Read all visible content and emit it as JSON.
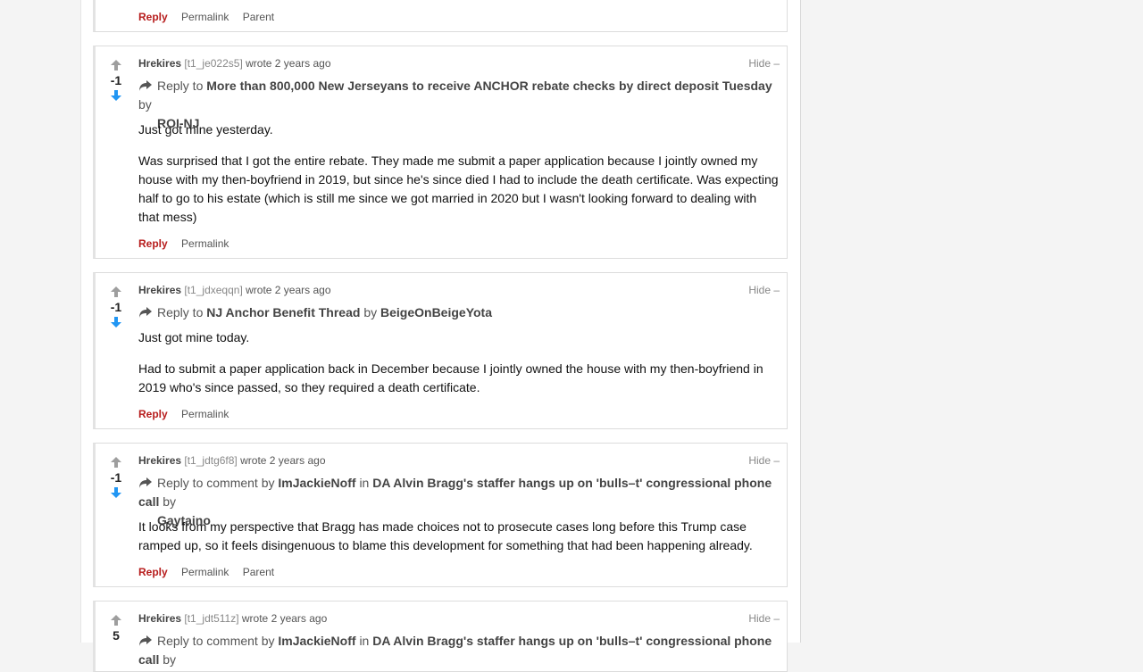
{
  "card0": {
    "actions": {
      "reply": "Reply",
      "permalink": "Permalink",
      "parent": "Parent"
    }
  },
  "card1": {
    "score": "-1",
    "author": "Hrekires",
    "comment_id": "[t1_je022s5]",
    "wrote": "wrote 2 years ago",
    "hide": "Hide –",
    "reply_prefix": "Reply to",
    "post_title": "More than 800,000 New Jerseyans to receive ANCHOR rebate checks by direct deposit Tuesday",
    "by_word": "by",
    "post_author": "ROI-NJ",
    "paragraphs": [
      "Just got mine yesterday.",
      "Was surprised that I got the entire rebate. They made me submit a paper application because I jointly owned my house with my then-boyfriend in 2019, but since he's since died I had to include the death certificate. Was expecting half to go to his estate (which is still me since we got married in 2020 but I wasn't looking forward to dealing with that mess)"
    ],
    "actions": {
      "reply": "Reply",
      "permalink": "Permalink"
    }
  },
  "card2": {
    "score": "-1",
    "author": "Hrekires",
    "comment_id": "[t1_jdxeqqn]",
    "wrote": "wrote 2 years ago",
    "hide": "Hide –",
    "reply_prefix": "Reply to",
    "post_title": "NJ Anchor Benefit Thread",
    "by_word": "by",
    "post_author": "BeigeOnBeigeYota",
    "paragraphs": [
      "Just got mine today.",
      "Had to submit a paper application back in December because I jointly owned the house with my then-boyfriend in 2019 who's since passed, so they required a death certificate."
    ],
    "actions": {
      "reply": "Reply",
      "permalink": "Permalink"
    }
  },
  "card3": {
    "score": "-1",
    "author": "Hrekires",
    "comment_id": "[t1_jdtg6f8]",
    "wrote": "wrote 2 years ago",
    "hide": "Hide –",
    "reply_prefix": "Reply to comment by",
    "comment_author": "ImJackieNoff",
    "in_word": "in",
    "post_title": "DA Alvin Bragg's staffer hangs up on 'bulls–t' congressional phone call",
    "by_word": "by",
    "post_author": "Gaytaino",
    "paragraphs": [
      "It looks from my perspective that Bragg has made choices not to prosecute cases long before this Trump case ramped up, so it feels disingenuous to blame this development for something that had been happening already."
    ],
    "actions": {
      "reply": "Reply",
      "permalink": "Permalink",
      "parent": "Parent"
    }
  },
  "card4": {
    "score": "5",
    "author": "Hrekires",
    "comment_id": "[t1_jdt511z]",
    "wrote": "wrote 2 years ago",
    "hide": "Hide –",
    "reply_prefix": "Reply to comment by",
    "comment_author": "ImJackieNoff",
    "in_word": "in",
    "post_title": "DA Alvin Bragg's staffer hangs up on 'bulls–t' congressional phone call",
    "by_word": "by"
  },
  "colors": {
    "accent_reply": "#b71c1c",
    "downvote": "#2196f3",
    "upvote": "#9e9e9e"
  },
  "icons": [
    "upvote-arrow-icon",
    "downvote-arrow-icon",
    "reply-arrow-icon"
  ]
}
